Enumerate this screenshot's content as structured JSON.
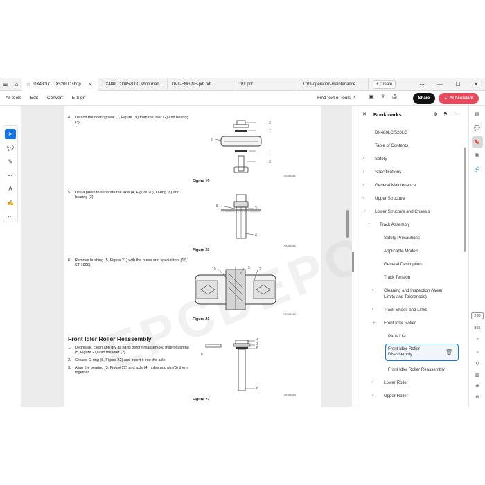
{
  "tabs": [
    {
      "label": "DX480LC DX520LC shop ...",
      "active": true
    },
    {
      "label": "DX480LC DX520LC shop man...",
      "active": false
    },
    {
      "label": "DVII-ENGINE-pdf.pdf",
      "active": false
    },
    {
      "label": "DVII.pdf",
      "active": false
    },
    {
      "label": "DVII-operation-maintenance...",
      "active": false
    }
  ],
  "create_label": "Create",
  "menu": {
    "all_tools": "All tools",
    "edit": "Edit",
    "convert": "Convert",
    "esign": "E-Sign",
    "find": "Find text or tools",
    "share": "Share",
    "ai_assistant": "AI Assistant"
  },
  "document": {
    "steps": [
      {
        "num": "4.",
        "text": "Detach the floating seal (7, Figure 19) from the idler (2) and bearing (3)."
      },
      {
        "num": "5.",
        "text": "Use a press to separate the axle (4, Figure 20), O-ring (8) and bearing (3)."
      },
      {
        "num": "6.",
        "text": "Remove bushing (5, Figure 21) with the press and special tool (10, ST-1909)."
      }
    ],
    "figures": [
      {
        "caption": "Figure 19",
        "code": "FG004361",
        "labels": [
          "3",
          "7",
          "2",
          "7",
          "3"
        ]
      },
      {
        "caption": "Figure 20",
        "code": "FG004362",
        "labels": [
          "8",
          "3",
          "4"
        ]
      },
      {
        "caption": "Figure 21",
        "code": "FG004363",
        "labels": [
          "10",
          "5",
          "2"
        ]
      },
      {
        "caption": "Figure 22",
        "code": "FG004364",
        "labels": [
          "4",
          "3",
          "8",
          "6",
          "8"
        ]
      }
    ],
    "section_title": "Front Idler Roller Reassembly",
    "reassembly_steps": [
      {
        "num": "1.",
        "text": "Degrease, clean and dry all parts before reassembly. Insert bushing (5, Figure 21) into the idler (2)."
      },
      {
        "num": "2.",
        "text": "Grease O-ring (8, Figure 22) and insert it into the axle."
      },
      {
        "num": "3.",
        "text": "Align the bearing (3, Figure 22) and axle (4) holes and pin (6) them together."
      }
    ],
    "watermark": "EPCDEPO.COM"
  },
  "bookmarks": {
    "title": "Bookmarks",
    "items": [
      {
        "label": "DX480LC/520LC",
        "chevron": ""
      },
      {
        "label": "Table of Contents",
        "chevron": ""
      },
      {
        "label": "Safety",
        "chevron": "›"
      },
      {
        "label": "Specifications",
        "chevron": "›"
      },
      {
        "label": "General Maintenance",
        "chevron": "›"
      },
      {
        "label": "Upper Structure",
        "chevron": "›"
      },
      {
        "label": "Lower Structure and Chassis",
        "chevron": "⌄"
      },
      {
        "label": "Track Assembly",
        "chevron": "⌄"
      },
      {
        "label": "Safety Precautions",
        "chevron": ""
      },
      {
        "label": "Applicable Models",
        "chevron": ""
      },
      {
        "label": "General Description",
        "chevron": ""
      },
      {
        "label": "Track Tension",
        "chevron": ""
      },
      {
        "label": "Cleaning and Inspection (Wear",
        "label2": "Limits and Tolerances)",
        "chevron": "›"
      },
      {
        "label": "Track Shoes and Links",
        "chevron": "›"
      },
      {
        "label": "Front Idler Roller",
        "chevron": "⌄"
      },
      {
        "label": "Parts List",
        "chevron": ""
      },
      {
        "label": "Front Idler Roller",
        "label2": "Disassembly",
        "chevron": "",
        "selected": true
      },
      {
        "label": "Front Idler Roller Reassembly",
        "chevron": ""
      },
      {
        "label": "Lower Roller",
        "chevron": "›"
      },
      {
        "label": "Upper Roller",
        "chevron": "›"
      }
    ]
  },
  "page_nav": {
    "current": "260",
    "total": "866"
  },
  "colors": {
    "accent": "#1473e6",
    "ai": "#e8495c"
  }
}
